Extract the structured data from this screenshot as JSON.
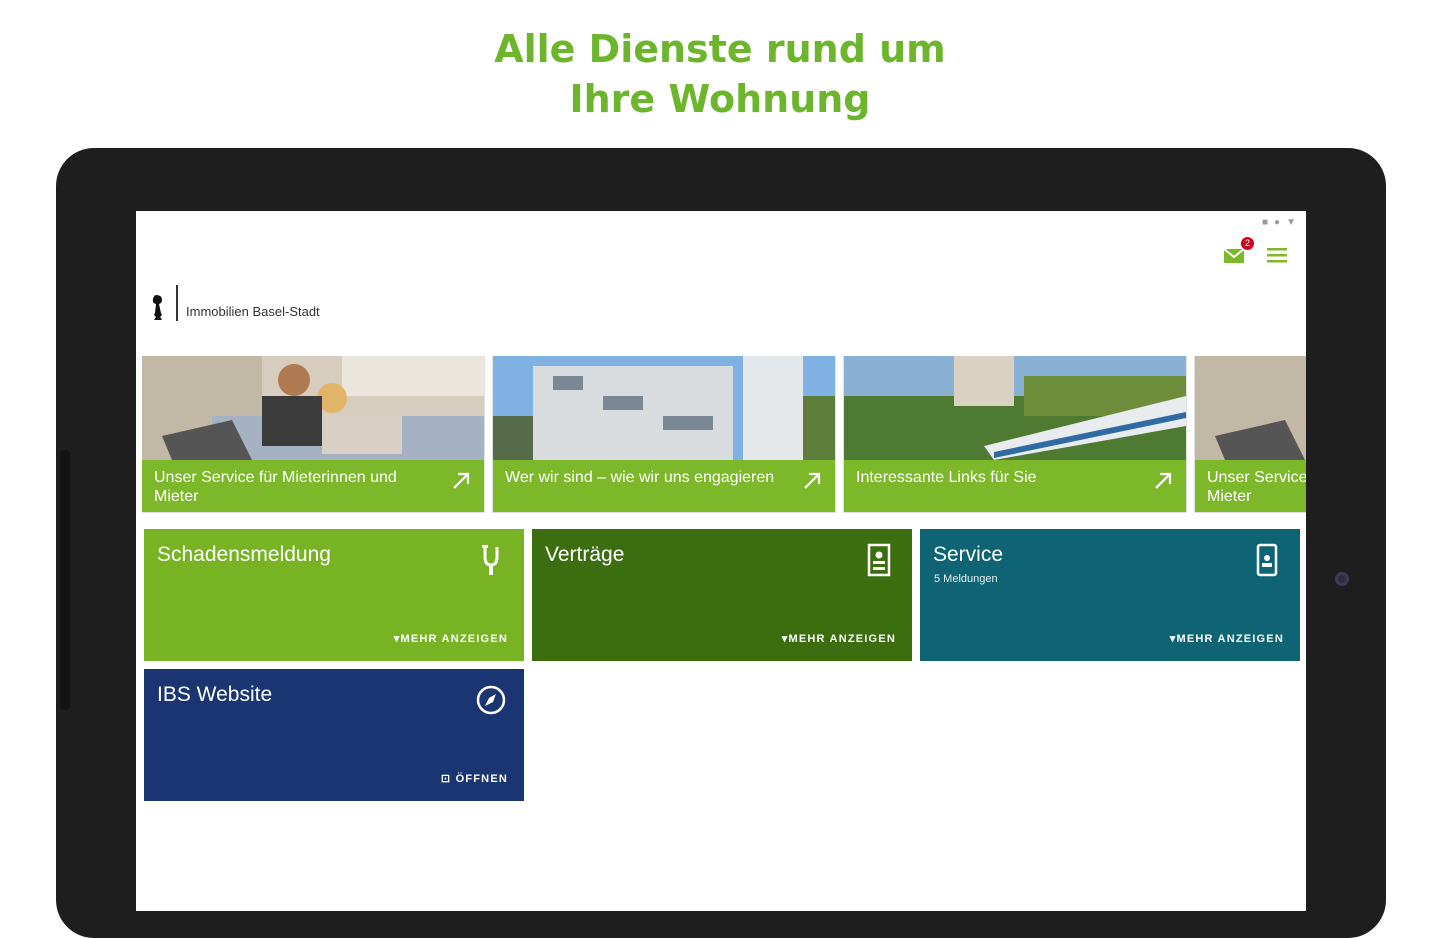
{
  "promo": {
    "line1": "Alle Dienste rund um",
    "line2": "Ihre Wohnung"
  },
  "app": {
    "logo_text": "Immobilien Basel-Stadt",
    "notifications_count": "2",
    "icons": {
      "mail": "mail-icon",
      "menu": "menu-icon"
    }
  },
  "carousel": [
    {
      "caption": "Unser Service für Mieterinnen und Mieter",
      "icon": "arrow-up-right-icon"
    },
    {
      "caption": "Wer wir sind – wie wir uns engagieren",
      "icon": "arrow-up-right-icon"
    },
    {
      "caption": "Interessante Links für Sie",
      "icon": "arrow-up-right-icon"
    },
    {
      "caption": "Unser Service für Mieterinnen und Mieter",
      "icon": "arrow-up-right-icon"
    }
  ],
  "tiles": [
    {
      "title": "Schadensmeldung",
      "subtitle": "",
      "action": "▾MEHR ANZEIGEN",
      "icon": "plunger-icon",
      "color": "#78b324"
    },
    {
      "title": "Verträge",
      "subtitle": "",
      "action": "▾MEHR ANZEIGEN",
      "icon": "contract-icon",
      "color": "#3c6e0f"
    },
    {
      "title": "Service",
      "subtitle": "5 Meldungen",
      "action": "▾MEHR ANZEIGEN",
      "icon": "phone-icon",
      "color": "#0e6472"
    },
    {
      "title": "IBS Website",
      "subtitle": "",
      "action": "⊡ ÖFFNEN",
      "icon": "compass-icon",
      "color": "#1b3572"
    }
  ],
  "colors": {
    "brand_green": "#6cb52d",
    "caption_green": "#7cb82a"
  }
}
